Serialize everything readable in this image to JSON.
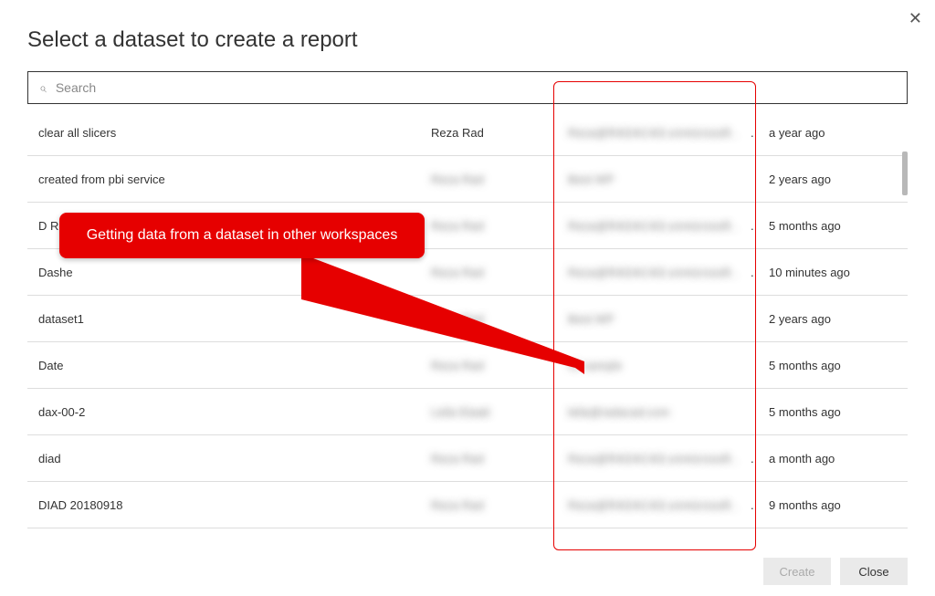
{
  "title": "Select a dataset to create a report",
  "search": {
    "placeholder": "Search",
    "value": ""
  },
  "rows": [
    {
      "name": "clear all slicers",
      "owner": "Reza Rad",
      "owner_blur": false,
      "workspace": "Reza@RADACAD.onmicrosoft .",
      "ws_dot": ".",
      "time": "a year ago"
    },
    {
      "name": "created from pbi service",
      "owner": "Reza Rad",
      "owner_blur": true,
      "workspace": "Best WP",
      "ws_dot": "",
      "time": "2 years ago"
    },
    {
      "name": "D RL",
      "owner": "Reza Rad",
      "owner_blur": true,
      "workspace": "Reza@RADACAD.onmicrosoft .",
      "ws_dot": ".",
      "time": "5 months ago"
    },
    {
      "name": "Dashe",
      "owner": "Reza Rad",
      "owner_blur": true,
      "workspace": "Reza@RADACAD.onmicrosoft .",
      "ws_dot": ".",
      "time": "10 minutes ago"
    },
    {
      "name": "dataset1",
      "owner": "Reza Rad",
      "owner_blur": true,
      "workspace": "Best WP",
      "ws_dot": "",
      "time": "2 years ago"
    },
    {
      "name": "Date",
      "owner": "Reza Rad",
      "owner_blur": true,
      "workspace": "v2 sample",
      "ws_dot": "",
      "time": "5 months ago"
    },
    {
      "name": "dax-00-2",
      "owner": "Leila Etaati",
      "owner_blur": true,
      "workspace": "leila@radacad.com",
      "ws_dot": "",
      "time": "5 months ago"
    },
    {
      "name": "diad",
      "owner": "Reza Rad",
      "owner_blur": true,
      "workspace": "Reza@RADACAD.onmicrosoft .",
      "ws_dot": ".",
      "time": "a month ago"
    },
    {
      "name": "DIAD 20180918",
      "owner": "Reza Rad",
      "owner_blur": true,
      "workspace": "Reza@RADACAD.onmicrosoft .",
      "ws_dot": ".",
      "time": "9 months ago"
    }
  ],
  "buttons": {
    "create": "Create",
    "close": "Close"
  },
  "callout": "Getting data from a dataset in other workspaces"
}
